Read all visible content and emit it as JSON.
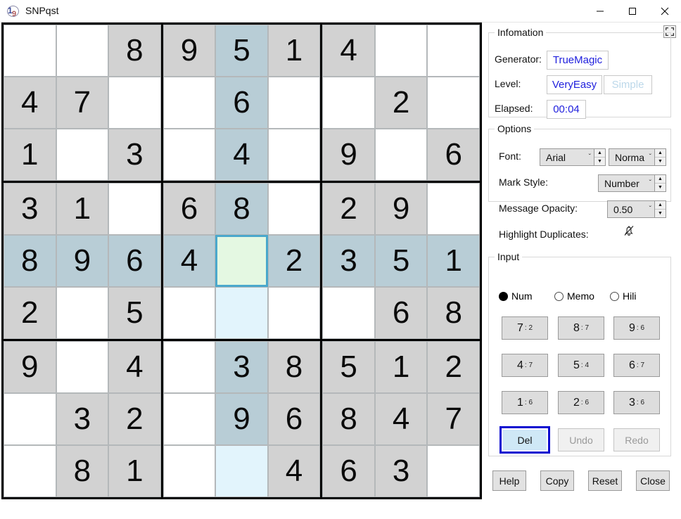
{
  "window": {
    "title": "SNPqst",
    "icon": "sudoku-app-icon",
    "minimize_label": "minimize-icon",
    "maximize_label": "maximize-icon",
    "close_label": "close-icon"
  },
  "board": {
    "name": "sudoku-grid",
    "rows": [
      [
        "",
        "",
        "8",
        "9",
        "5",
        "1",
        "4",
        "",
        ""
      ],
      [
        "4",
        "7",
        "",
        "",
        "6",
        "",
        "",
        "2",
        ""
      ],
      [
        "1",
        "",
        "3",
        "",
        "4",
        "",
        "9",
        "",
        "6"
      ],
      [
        "3",
        "1",
        "",
        "6",
        "8",
        "",
        "2",
        "9",
        ""
      ],
      [
        "8",
        "9",
        "6",
        "4",
        "",
        "2",
        "3",
        "5",
        "1"
      ],
      [
        "2",
        "",
        "5",
        "",
        "",
        "",
        "",
        "6",
        "8"
      ],
      [
        "9",
        "",
        "4",
        "",
        "3",
        "8",
        "5",
        "1",
        "2"
      ],
      [
        "",
        "3",
        "2",
        "",
        "9",
        "6",
        "8",
        "4",
        "7"
      ],
      [
        "",
        "8",
        "1",
        "",
        "",
        "4",
        "6",
        "3",
        ""
      ]
    ],
    "selected_cell": {
      "row": 4,
      "col": 4
    },
    "highlight_row": 4,
    "highlight_col": 4,
    "colors": {
      "given_bg": "#d2d2d2",
      "empty_bg": "#ffffff",
      "highlight_bg": "#b8cdd6",
      "highlight_soft_bg": "#e2f4fc",
      "selected_bg": "#e4f8e2",
      "selected_border": "#4aa8cc",
      "grid_line": "#000000"
    }
  },
  "information": {
    "legend": "Infomation",
    "expand_icon": "expand-icon",
    "generator_label": "Generator:",
    "generator_value": "TrueMagic",
    "level_label": "Level:",
    "level_value": "VeryEasy",
    "level_secondary": "Simple",
    "elapsed_label": "Elapsed:",
    "elapsed_value": "00:04",
    "value_color": "#2020dd",
    "dim_color": "#bcd8ea"
  },
  "options": {
    "legend": "Options",
    "font_label": "Font:",
    "font_family_value": "Arial",
    "font_weight_value": "Norma",
    "mark_style_label": "Mark Style:",
    "mark_style_value": "Number",
    "message_opacity_label": "Message Opacity:",
    "message_opacity_value": "0.50",
    "highlight_duplicates_label": "Highlight Duplicates:",
    "highlight_duplicates_icon": "bell-off-icon",
    "spin_up": "▲",
    "spin_down": "▼",
    "combo_arrow": "ˇ"
  },
  "input": {
    "legend": "Input",
    "modes": [
      {
        "label": "Num",
        "selected": true
      },
      {
        "label": "Memo",
        "selected": false
      },
      {
        "label": "Hili",
        "selected": false
      }
    ],
    "number_buttons": [
      {
        "digit": "7",
        "count": ": 2"
      },
      {
        "digit": "8",
        "count": ": 7"
      },
      {
        "digit": "9",
        "count": ": 6"
      },
      {
        "digit": "4",
        "count": ": 7"
      },
      {
        "digit": "5",
        "count": ": 4"
      },
      {
        "digit": "6",
        "count": ": 7"
      },
      {
        "digit": "1",
        "count": ": 6"
      },
      {
        "digit": "2",
        "count": ": 6"
      },
      {
        "digit": "3",
        "count": ": 6"
      }
    ],
    "del_label": "Del",
    "undo_label": "Undo",
    "redo_label": "Redo",
    "del_focus_color": "#0a0ad0",
    "del_fill_color": "#cfe8f6"
  },
  "footer": {
    "help_label": "Help",
    "copy_label": "Copy",
    "reset_label": "Reset",
    "close_label": "Close"
  }
}
